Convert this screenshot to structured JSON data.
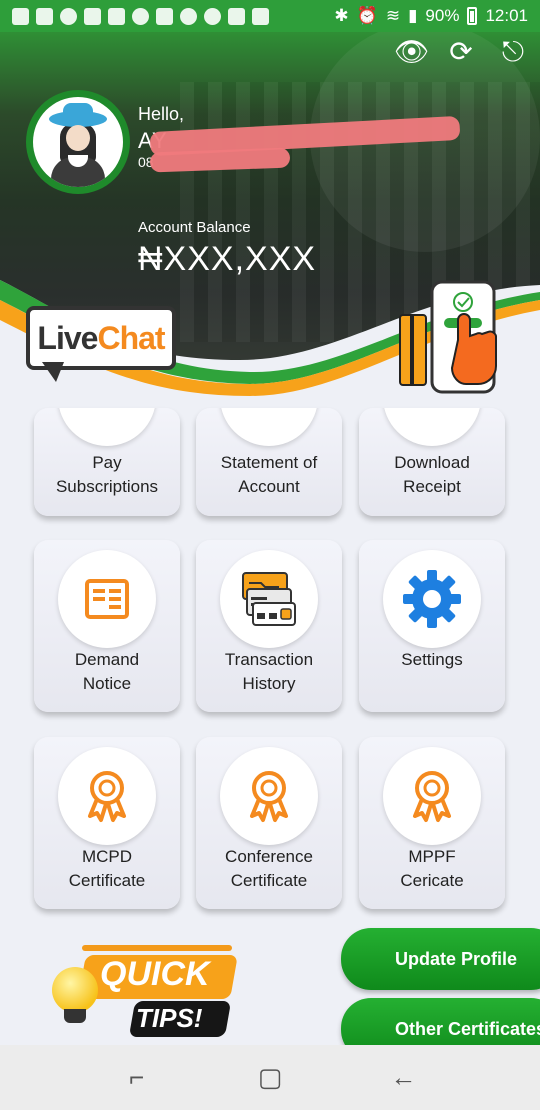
{
  "status_bar": {
    "battery": "90%",
    "time": "12:01"
  },
  "header": {
    "greeting": "Hello,",
    "name": "AY",
    "phone": "08",
    "balance_label": "Account Balance",
    "balance_value": "₦XXX,XXX",
    "icons": [
      "eye-icon",
      "refresh-icon",
      "logout-icon"
    ]
  },
  "livechat": {
    "live": "Live",
    "chat": "Chat"
  },
  "grid": {
    "items": [
      {
        "label": "Pay\nSubscriptions",
        "icon": "subscription-icon"
      },
      {
        "label": "Statement of\nAccount",
        "icon": "statement-icon"
      },
      {
        "label": "Download\nReceipt",
        "icon": "receipt-icon"
      },
      {
        "label": "Demand\nNotice",
        "icon": "notice-icon"
      },
      {
        "label": "Transaction\nHistory",
        "icon": "transaction-icon"
      },
      {
        "label": "Settings",
        "icon": "gear-icon"
      },
      {
        "label": "MCPD\nCertificate",
        "icon": "award-icon"
      },
      {
        "label": "Conference\nCertificate",
        "icon": "award-icon"
      },
      {
        "label": "MPPF\nCericate",
        "icon": "award-icon"
      }
    ]
  },
  "quick_tips": {
    "line1": "QUICK",
    "line2": "TIPS!"
  },
  "buttons": {
    "update_profile": "Update Profile",
    "other_certificates": "Other Certificates"
  },
  "colors": {
    "brand_green": "#2e9e3a",
    "accent_orange": "#f48a1f",
    "gear_blue": "#1e7fe0"
  }
}
